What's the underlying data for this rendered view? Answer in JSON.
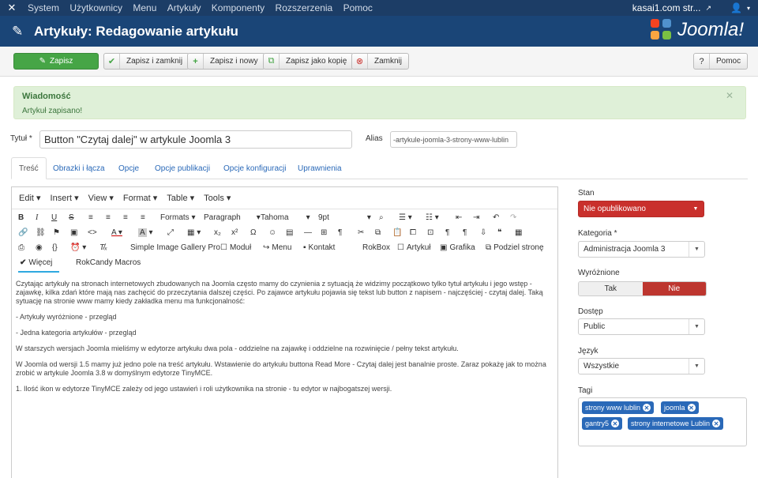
{
  "topbar": {
    "menu": [
      "System",
      "Użytkownicy",
      "Menu",
      "Artykuły",
      "Komponenty",
      "Rozszerzenia",
      "Pomoc"
    ],
    "site": "kasai1.com str..."
  },
  "header": {
    "title": "Artykuły: Redagowanie artykułu",
    "brand": "Joomla!"
  },
  "toolbar": {
    "save": "Zapisz",
    "save_close": "Zapisz i zamknij",
    "save_new": "Zapisz i nowy",
    "save_copy": "Zapisz jako kopię",
    "close": "Zamknij",
    "help": "Pomoc"
  },
  "message": {
    "heading": "Wiadomość",
    "text": "Artykuł zapisano!"
  },
  "form": {
    "title_label": "Tytuł *",
    "title_value": "Button \"Czytaj dalej\" w artykule Joomla 3",
    "alias_label": "Alias",
    "alias_value": "-artykule-joomla-3-strony-www-lublin"
  },
  "tabs": [
    "Treść",
    "Obrazki i łącza",
    "Opcje",
    "Opcje publikacji",
    "Opcje konfiguracji",
    "Uprawnienia"
  ],
  "editor": {
    "menus": [
      "Edit ▾",
      "Insert ▾",
      "View ▾",
      "Format ▾",
      "Table ▾",
      "Tools ▾"
    ],
    "formats": "Formats",
    "paragraph": "Paragraph",
    "font": "Tahoma",
    "size": "9pt",
    "buttons": [
      "Simple Image Gallery Pro",
      "Moduł",
      "Menu",
      "Kontakt",
      "RokBox",
      "Artykuł",
      "Grafika",
      "Podziel stronę"
    ],
    "more": "Więcej",
    "rokcandy": "RokCandy Macros",
    "p1": "Czytając artykuły na stronach internetowych zbudowanych na Joomla często mamy do czynienia z sytuacją że widzimy początkowo tylko tytuł artykułu i jego wstęp - zajawkę, kilka zdań które mają nas zachęcić do przeczytania dalszej części. Po zajawce artykułu pojawia się  tekst lub button z napisem - najczęściej - czytaj dalej.  Taką sytuację na stronie www mamy kiedy zakładka menu ma funkcjonalność:",
    "p2": "- Artykuły wyróżnione - przegląd",
    "p3": "- Jedna kategoria artykułów - przegląd",
    "p4": "W starszych wersjach Joomla mieliśmy w edytorze artykułu dwa pola - oddzielne na zajawkę i oddzielne na rozwinięcie / pełny tekst artykułu.",
    "p5": "W Joomla od wersji 1.5 mamy już jedno pole na treść artykułu. Wstawienie do artykułu buttona Read More - Czytaj dalej jest banalnie proste. Zaraz pokażę jak to można zrobić w artykule Joomla 3.8 w domyślnym edytorze TinyMCE.",
    "p6": "1. Ilość ikon w edytorze TinyMCE zależy od jego ustawień i roli użytkownika na stronie - tu edytor w najbogatszej wersji."
  },
  "sidebar": {
    "status_label": "Stan",
    "status_value": "Nie opublikowano",
    "category_label": "Kategoria *",
    "category_value": "Administracja Joomla 3",
    "featured_label": "Wyróżnione",
    "featured_yes": "Tak",
    "featured_no": "Nie",
    "access_label": "Dostęp",
    "access_value": "Public",
    "language_label": "Język",
    "language_value": "Wszystkie",
    "tags_label": "Tagi",
    "tags": [
      "strony www lublin",
      "joomla",
      "gantry5",
      "strony internetowe Lublin"
    ]
  },
  "colors": {
    "topbar": "#1c3d66",
    "header": "#1a4577",
    "save": "#46a546",
    "unpublished": "#c9302c",
    "featured_no": "#bd362f",
    "tag": "#2a69b8"
  }
}
